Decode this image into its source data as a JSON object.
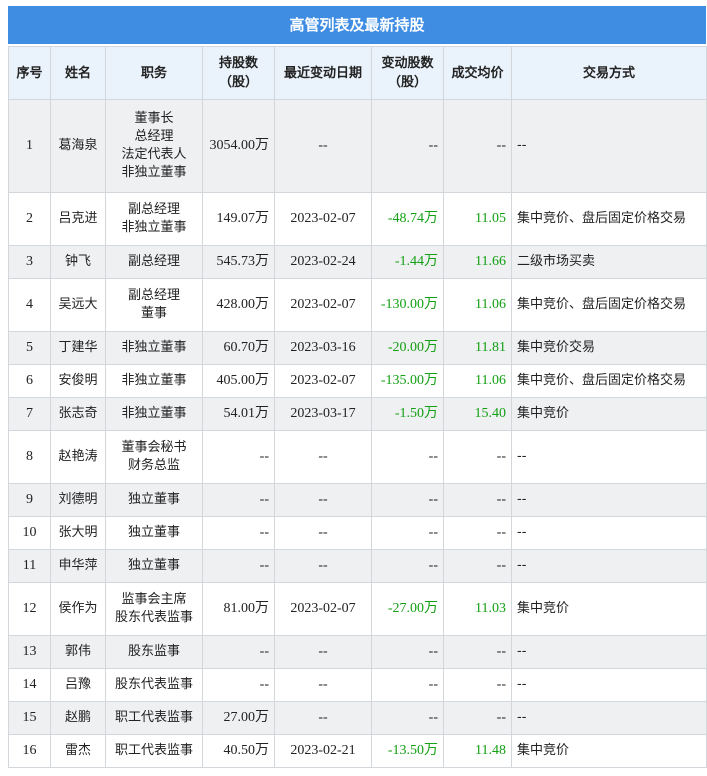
{
  "title": "高管列表及最新持股",
  "columns": [
    "序号",
    "姓名",
    "职务",
    "持股数\n（股）",
    "最近变动日期",
    "变动股数\n（股）",
    "成交均价",
    "交易方式"
  ],
  "colors": {
    "header_bg": "#3f8de3",
    "positive_change": "#13a013",
    "stripe": "#eef0f2"
  },
  "rows": [
    {
      "idx": "1",
      "name": "葛海泉",
      "positions": [
        "董事长",
        "总经理",
        "法定代表人",
        "非独立董事"
      ],
      "shares": "3054.00万",
      "date": "--",
      "change": "--",
      "price": "--",
      "method": "--"
    },
    {
      "idx": "2",
      "name": "吕克进",
      "positions": [
        "副总经理",
        "非独立董事"
      ],
      "shares": "149.07万",
      "date": "2023-02-07",
      "change": "-48.74万",
      "price": "11.05",
      "method": "集中竞价、盘后固定价格交易"
    },
    {
      "idx": "3",
      "name": "钟飞",
      "positions": [
        "副总经理"
      ],
      "shares": "545.73万",
      "date": "2023-02-24",
      "change": "-1.44万",
      "price": "11.66",
      "method": "二级市场买卖"
    },
    {
      "idx": "4",
      "name": "吴远大",
      "positions": [
        "副总经理",
        "董事"
      ],
      "shares": "428.00万",
      "date": "2023-02-07",
      "change": "-130.00万",
      "price": "11.06",
      "method": "集中竞价、盘后固定价格交易"
    },
    {
      "idx": "5",
      "name": "丁建华",
      "positions": [
        "非独立董事"
      ],
      "shares": "60.70万",
      "date": "2023-03-16",
      "change": "-20.00万",
      "price": "11.81",
      "method": "集中竞价交易"
    },
    {
      "idx": "6",
      "name": "安俊明",
      "positions": [
        "非独立董事"
      ],
      "shares": "405.00万",
      "date": "2023-02-07",
      "change": "-135.00万",
      "price": "11.06",
      "method": "集中竞价、盘后固定价格交易"
    },
    {
      "idx": "7",
      "name": "张志奇",
      "positions": [
        "非独立董事"
      ],
      "shares": "54.01万",
      "date": "2023-03-17",
      "change": "-1.50万",
      "price": "15.40",
      "method": "集中竞价"
    },
    {
      "idx": "8",
      "name": "赵艳涛",
      "positions": [
        "董事会秘书",
        "财务总监"
      ],
      "shares": "--",
      "date": "--",
      "change": "--",
      "price": "--",
      "method": "--"
    },
    {
      "idx": "9",
      "name": "刘德明",
      "positions": [
        "独立董事"
      ],
      "shares": "--",
      "date": "--",
      "change": "--",
      "price": "--",
      "method": "--"
    },
    {
      "idx": "10",
      "name": "张大明",
      "positions": [
        "独立董事"
      ],
      "shares": "--",
      "date": "--",
      "change": "--",
      "price": "--",
      "method": "--"
    },
    {
      "idx": "11",
      "name": "申华萍",
      "positions": [
        "独立董事"
      ],
      "shares": "--",
      "date": "--",
      "change": "--",
      "price": "--",
      "method": "--"
    },
    {
      "idx": "12",
      "name": "侯作为",
      "positions": [
        "监事会主席",
        "股东代表监事"
      ],
      "shares": "81.00万",
      "date": "2023-02-07",
      "change": "-27.00万",
      "price": "11.03",
      "method": "集中竞价"
    },
    {
      "idx": "13",
      "name": "郭伟",
      "positions": [
        "股东监事"
      ],
      "shares": "--",
      "date": "--",
      "change": "--",
      "price": "--",
      "method": "--"
    },
    {
      "idx": "14",
      "name": "吕豫",
      "positions": [
        "股东代表监事"
      ],
      "shares": "--",
      "date": "--",
      "change": "--",
      "price": "--",
      "method": "--"
    },
    {
      "idx": "15",
      "name": "赵鹏",
      "positions": [
        "职工代表监事"
      ],
      "shares": "27.00万",
      "date": "--",
      "change": "--",
      "price": "--",
      "method": "--"
    },
    {
      "idx": "16",
      "name": "雷杰",
      "positions": [
        "职工代表监事"
      ],
      "shares": "40.50万",
      "date": "2023-02-21",
      "change": "-13.50万",
      "price": "11.48",
      "method": "集中竞价"
    }
  ]
}
